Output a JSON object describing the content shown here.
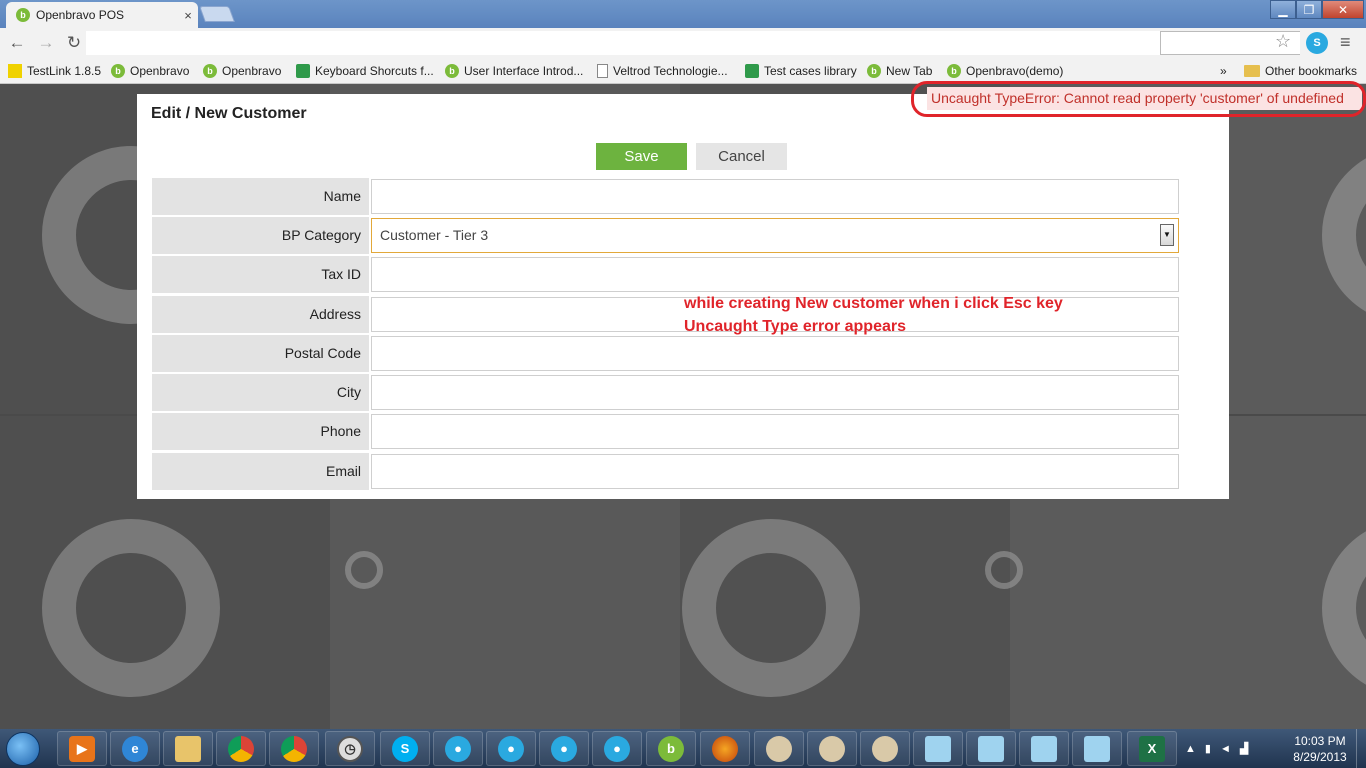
{
  "browser": {
    "tab_title": "Openbravo POS",
    "tab_close": "×",
    "minimize": "▁",
    "restore": "❐",
    "close": "✕",
    "back": "←",
    "forward": "→",
    "reload": "↻",
    "star": "☆",
    "ext_label": "S",
    "menu": "≡",
    "bookmarks": [
      {
        "label": "TestLink 1.8.5",
        "icon": "testlink-icon"
      },
      {
        "label": "Openbravo",
        "icon": "openbravo-icon"
      },
      {
        "label": "Openbravo",
        "icon": "openbravo-icon"
      },
      {
        "label": "Keyboard Shorcuts f...",
        "icon": "spreadsheet-icon"
      },
      {
        "label": "User Interface Introd...",
        "icon": "openbravo-icon"
      },
      {
        "label": "Veltrod Technologie...",
        "icon": "document-icon"
      },
      {
        "label": "Test cases library",
        "icon": "spreadsheet-icon"
      },
      {
        "label": "New Tab",
        "icon": "openbravo-icon"
      },
      {
        "label": "Openbravo(demo)",
        "icon": "openbravo-icon"
      }
    ],
    "bookmarks_overflow": "»",
    "other_bookmarks": "Other bookmarks"
  },
  "error": {
    "message": "Uncaught TypeError: Cannot read property 'customer' of undefined"
  },
  "modal": {
    "title": "Edit / New Customer",
    "save_label": "Save",
    "cancel_label": "Cancel",
    "fields": [
      {
        "label": "Name",
        "value": ""
      },
      {
        "label": "BP Category",
        "value": "Customer - Tier 3"
      },
      {
        "label": "Tax ID",
        "value": ""
      },
      {
        "label": "Address",
        "value": ""
      },
      {
        "label": "Postal Code",
        "value": ""
      },
      {
        "label": "City",
        "value": ""
      },
      {
        "label": "Phone",
        "value": ""
      },
      {
        "label": "Email",
        "value": ""
      }
    ],
    "dropdown_arrow": "▼"
  },
  "annotation": {
    "line1": "while creating New customer when i click  Esc key",
    "line2": "Uncaught Type error appears"
  },
  "taskbar": {
    "icons": [
      "media-player-icon",
      "internet-explorer-icon",
      "file-explorer-icon",
      "chrome-icon",
      "chrome-icon",
      "clock-icon",
      "skype-icon",
      "chat-icon",
      "chat-icon",
      "chat-icon",
      "chat-icon",
      "openbravo-icon",
      "firefox-icon",
      "paint-icon",
      "paint-icon",
      "paint-icon",
      "notepad-icon",
      "notepad-icon",
      "notepad-icon",
      "notepad-icon",
      "excel-icon"
    ],
    "time": "10:03 PM",
    "date": "8/29/2013"
  }
}
